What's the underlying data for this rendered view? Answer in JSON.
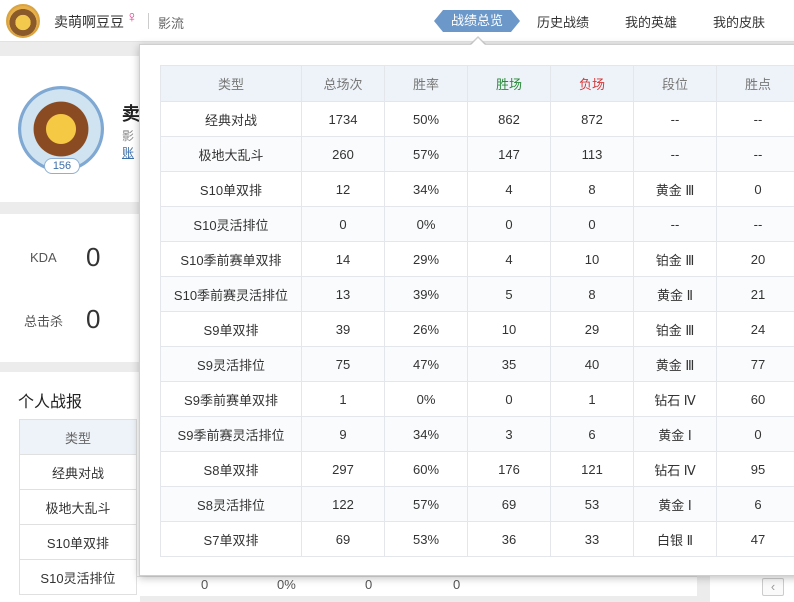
{
  "header": {
    "player_name": "卖萌啊豆豆",
    "gender_icon": "female-symbol-icon",
    "gender_glyph": "♀",
    "server": "影流",
    "nav": [
      "战绩总览",
      "历史战绩",
      "我的英雄",
      "我的皮肤"
    ],
    "active_nav": "战绩总览"
  },
  "profile": {
    "name_fragment": "卖",
    "sub1_fragment": "影",
    "sub2_fragment": "账",
    "level": "156"
  },
  "stats": {
    "kda_label": "KDA",
    "kda_value": "0",
    "kills_label": "总击杀",
    "kills_value": "0"
  },
  "personal": {
    "title": "个人战报",
    "header": "类型",
    "rows": [
      "经典对战",
      "极地大乱斗",
      "S10单双排",
      "S10灵活排位"
    ],
    "partial_values": [
      "0",
      "0%",
      "0",
      "0"
    ]
  },
  "popup": {
    "columns": [
      "类型",
      "总场次",
      "胜率",
      "胜场",
      "负场",
      "段位",
      "胜点"
    ],
    "win_color": "#2a8a3a",
    "loss_color": "#d33a3a",
    "rows": [
      [
        "经典对战",
        "1734",
        "50%",
        "862",
        "872",
        "--",
        "--"
      ],
      [
        "极地大乱斗",
        "260",
        "57%",
        "147",
        "113",
        "--",
        "--"
      ],
      [
        "S10单双排",
        "12",
        "34%",
        "4",
        "8",
        "黄金 Ⅲ",
        "0"
      ],
      [
        "S10灵活排位",
        "0",
        "0%",
        "0",
        "0",
        "--",
        "--"
      ],
      [
        "S10季前赛单双排",
        "14",
        "29%",
        "4",
        "10",
        "铂金 Ⅲ",
        "20"
      ],
      [
        "S10季前赛灵活排位",
        "13",
        "39%",
        "5",
        "8",
        "黄金 Ⅱ",
        "21"
      ],
      [
        "S9单双排",
        "39",
        "26%",
        "10",
        "29",
        "铂金 Ⅲ",
        "24"
      ],
      [
        "S9灵活排位",
        "75",
        "47%",
        "35",
        "40",
        "黄金 Ⅲ",
        "77"
      ],
      [
        "S9季前赛单双排",
        "1",
        "0%",
        "0",
        "1",
        "钻石 Ⅳ",
        "60"
      ],
      [
        "S9季前赛灵活排位",
        "9",
        "34%",
        "3",
        "6",
        "黄金 Ⅰ",
        "0"
      ],
      [
        "S8单双排",
        "297",
        "60%",
        "176",
        "121",
        "钻石 Ⅳ",
        "95"
      ],
      [
        "S8灵活排位",
        "122",
        "57%",
        "69",
        "53",
        "黄金 Ⅰ",
        "6"
      ],
      [
        "S7单双排",
        "69",
        "53%",
        "36",
        "33",
        "白银 Ⅱ",
        "47"
      ]
    ]
  },
  "scroll": {
    "left_glyph": "‹"
  }
}
